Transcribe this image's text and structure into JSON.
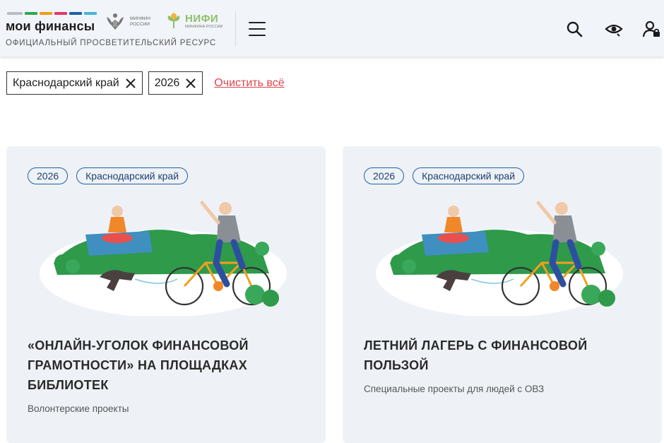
{
  "header": {
    "brand": "мои финансы",
    "tagline": "ОФИЦИАЛЬНЫЙ ПРОСВЕТИТЕЛЬСКИЙ РЕСУРС",
    "minfin_line1": "МИНФИН",
    "minfin_line2": "РОССИИ",
    "nifi_name": "НИФИ",
    "nifi_sub": "МИНФИНА РОССИИ",
    "stripe_colors": [
      "#b9bec6",
      "#2fa84f",
      "#f29b1d",
      "#e6356b",
      "#1f5ea8",
      "#4ab3d8"
    ],
    "icons": [
      "menu-icon",
      "search-icon",
      "eye-icon",
      "user-lock-icon"
    ]
  },
  "filters": {
    "chips": [
      {
        "label": "Краснодарский край"
      },
      {
        "label": "2026"
      }
    ],
    "clear_label": "Очистить всё"
  },
  "cards": [
    {
      "tags": [
        "2026",
        "Краснодарский край"
      ],
      "title": "«ОНЛАЙН-УГОЛОК ФИНАНСОВОЙ ГРАМОТНОСТИ» НА ПЛОЩАДКАХ БИБЛИОТЕК",
      "category": "Волонтерские проекты"
    },
    {
      "tags": [
        "2026",
        "Краснодарский край"
      ],
      "title": "ЛЕТНИЙ ЛАГЕРЬ С ФИНАНСОВОЙ ПОЛЬЗОЙ",
      "category": "Специальные проекты для людей с ОВЗ"
    }
  ],
  "colors": {
    "accent_blue": "#1f5ea8",
    "clear_red": "#e0454d",
    "card_bg": "#eef2f7",
    "illus_green": "#2e9a4a"
  }
}
